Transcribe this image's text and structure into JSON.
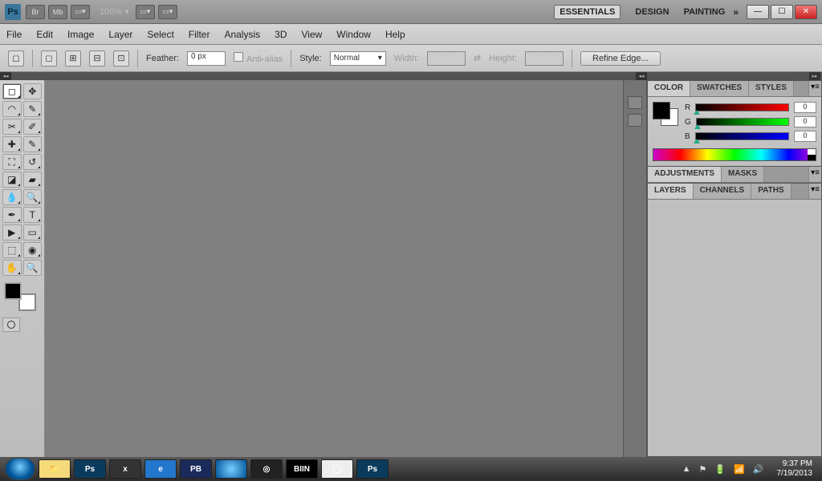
{
  "appbar": {
    "logo": "Ps",
    "br": "Br",
    "mb": "Mb",
    "zoom": "100%",
    "workspaces": [
      "ESSENTIALS",
      "DESIGN",
      "PAINTING"
    ]
  },
  "menu": [
    "File",
    "Edit",
    "Image",
    "Layer",
    "Select",
    "Filter",
    "Analysis",
    "3D",
    "View",
    "Window",
    "Help"
  ],
  "options": {
    "feather_label": "Feather:",
    "feather_value": "0 px",
    "antialias": "Anti-alias",
    "style_label": "Style:",
    "style_value": "Normal",
    "width_label": "Width:",
    "height_label": "Height:",
    "refine": "Refine Edge..."
  },
  "panels": {
    "colorTabs": [
      "COLOR",
      "SWATCHES",
      "STYLES"
    ],
    "channels": [
      {
        "label": "R",
        "value": "0",
        "cls": "r"
      },
      {
        "label": "G",
        "value": "0",
        "cls": "g"
      },
      {
        "label": "B",
        "value": "0",
        "cls": "b"
      }
    ],
    "adjTabs": [
      "ADJUSTMENTS",
      "MASKS"
    ],
    "layerTabs": [
      "LAYERS",
      "CHANNELS",
      "PATHS"
    ]
  },
  "taskbar": {
    "apps": [
      {
        "label": "📁",
        "bg": "#f5da7a"
      },
      {
        "label": "Ps",
        "bg": "#0a3b5c"
      },
      {
        "label": "x",
        "bg": "#333"
      },
      {
        "label": "e",
        "bg": "#2277cc"
      },
      {
        "label": "PB",
        "bg": "#1a2a5a"
      },
      {
        "label": "",
        "bg": "radial-gradient(circle,#7cf,#059)"
      },
      {
        "label": "◎",
        "bg": "#222"
      },
      {
        "label": "BIIN",
        "bg": "#000"
      },
      {
        "label": "◯",
        "bg": "#eee"
      },
      {
        "label": "Ps",
        "bg": "#0a3b5c"
      }
    ],
    "tray": [
      "▲",
      "⚑",
      "🔋",
      "📶",
      "🔊"
    ],
    "time": "9:37 PM",
    "date": "7/19/2013"
  }
}
